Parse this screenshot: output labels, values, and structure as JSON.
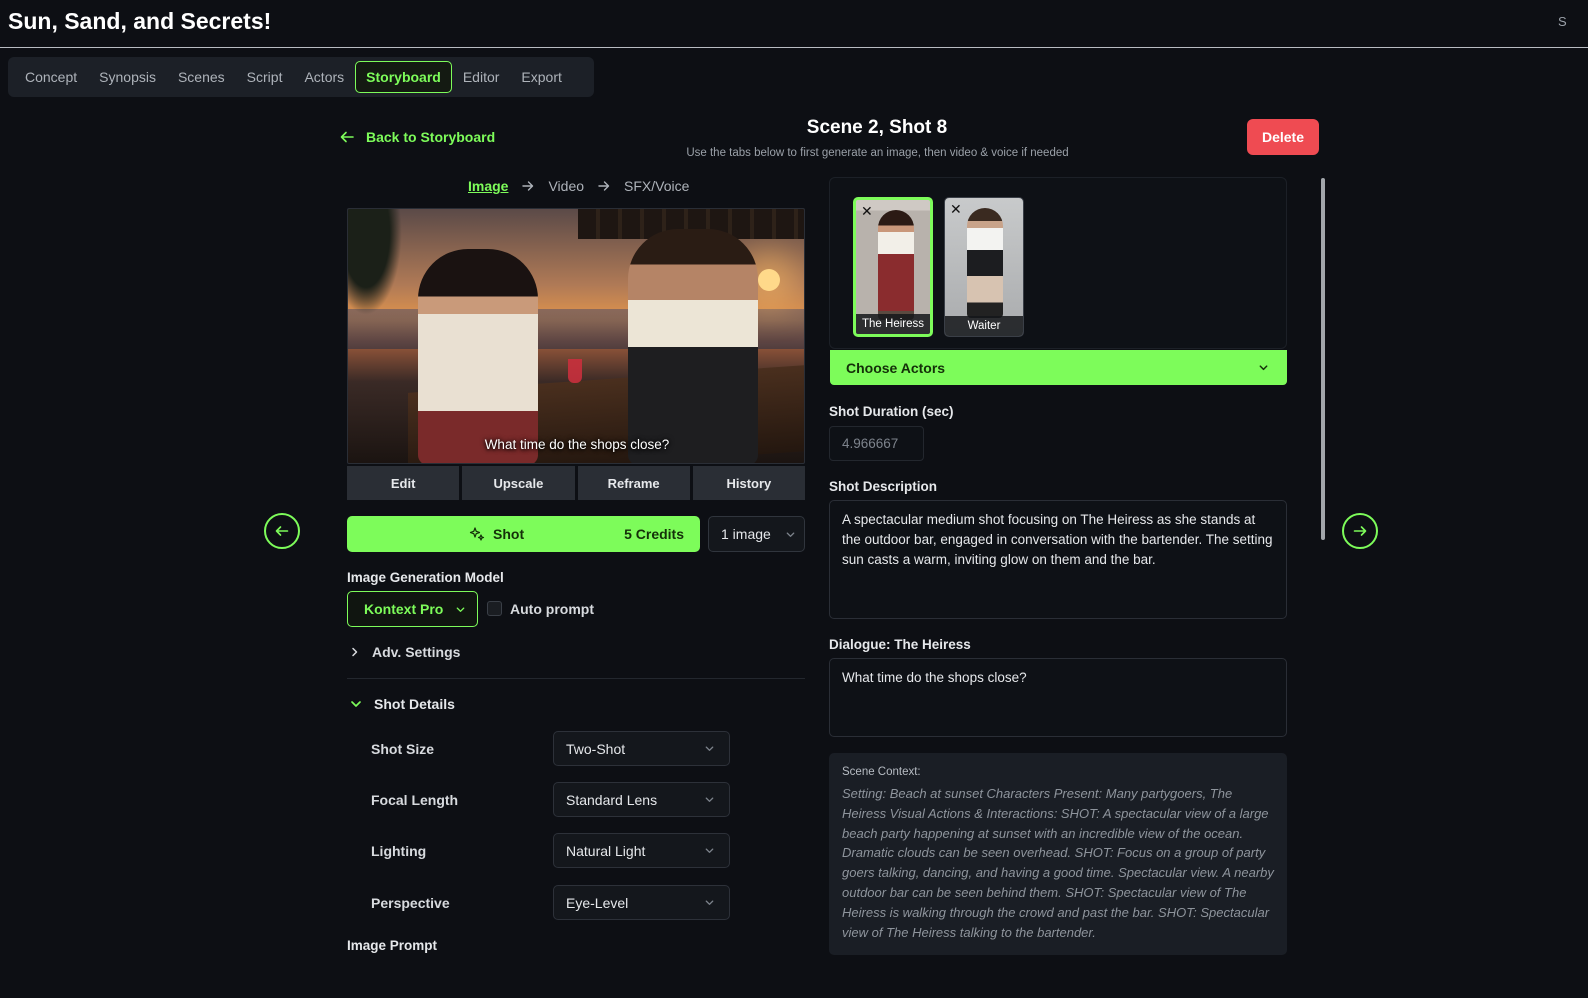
{
  "app": {
    "title": "Sun, Sand, and Secrets!",
    "top_right_clip": "S"
  },
  "tabs": [
    {
      "label": "Concept"
    },
    {
      "label": "Synopsis"
    },
    {
      "label": "Scenes"
    },
    {
      "label": "Script"
    },
    {
      "label": "Actors"
    },
    {
      "label": "Storyboard",
      "active": true
    },
    {
      "label": "Editor"
    },
    {
      "label": "Export"
    }
  ],
  "header": {
    "back_label": "Back to Storyboard",
    "shot_title": "Scene 2, Shot 8",
    "subtitle": "Use the tabs below to first generate an image, then video & voice if needed",
    "delete_label": "Delete"
  },
  "steps": [
    {
      "label": "Image",
      "active": true
    },
    {
      "label": "Video"
    },
    {
      "label": "SFX/Voice"
    }
  ],
  "preview": {
    "caption": "What time do the shops close?"
  },
  "image_actions": [
    {
      "label": "Edit"
    },
    {
      "label": "Upscale"
    },
    {
      "label": "Reframe"
    },
    {
      "label": "History"
    }
  ],
  "generate": {
    "label": "Shot",
    "credits": "5 Credits",
    "count": "1 image"
  },
  "model": {
    "label": "Image Generation Model",
    "value": "Kontext Pro",
    "auto_prompt_label": "Auto prompt",
    "auto_prompt_checked": false
  },
  "adv_settings": {
    "label": "Adv. Settings"
  },
  "shot_details": {
    "label": "Shot Details",
    "fields": [
      {
        "label": "Shot Size",
        "value": "Two-Shot"
      },
      {
        "label": "Focal Length",
        "value": "Standard Lens"
      },
      {
        "label": "Lighting",
        "value": "Natural Light"
      },
      {
        "label": "Perspective",
        "value": "Eye-Level"
      }
    ]
  },
  "image_prompt": {
    "label": "Image Prompt"
  },
  "actors": {
    "items": [
      {
        "name": "The Heiress",
        "selected": true
      },
      {
        "name": "Waiter",
        "selected": false
      }
    ],
    "choose_label": "Choose Actors",
    "remove_glyph": "✕"
  },
  "duration": {
    "label": "Shot Duration (sec)",
    "value": "4.966667"
  },
  "description": {
    "label": "Shot Description",
    "value": "A spectacular medium shot focusing on The Heiress as she stands at the outdoor bar, engaged in conversation with the bartender. The setting sun casts a warm, inviting glow on them and the bar."
  },
  "dialogue": {
    "label": "Dialogue: The Heiress",
    "value": "What time do the shops close?"
  },
  "scene_context": {
    "title": "Scene Context:",
    "text": "Setting: Beach at sunset Characters Present: Many partygoers, The Heiress Visual Actions & Interactions: SHOT: A spectacular view of a large beach party happening at sunset with an incredible view of the ocean. Dramatic clouds can be seen overhead. SHOT: Focus on a group of party goers talking, dancing, and having a good time. Spectacular view. A nearby outdoor bar can be seen behind them. SHOT: Spectacular view of The Heiress is walking through the crowd and past the bar. SHOT: Spectacular view of The Heiress talking to the bartender."
  },
  "colors": {
    "accent": "#7dfc5a",
    "danger": "#ef4b52",
    "background": "#0d0f14"
  }
}
